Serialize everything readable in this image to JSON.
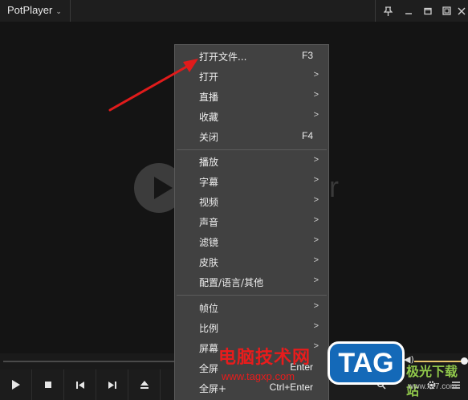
{
  "app": {
    "title": "PotPlayer",
    "logo_text": "r"
  },
  "menu": {
    "groups": [
      [
        {
          "label": "打开文件...",
          "shortcut": "F3"
        },
        {
          "label": "打开",
          "arrow": ">"
        },
        {
          "label": "直播",
          "arrow": ">"
        },
        {
          "label": "收藏",
          "arrow": ">"
        },
        {
          "label": "关闭",
          "shortcut": "F4"
        }
      ],
      [
        {
          "label": "播放",
          "arrow": ">"
        },
        {
          "label": "字幕",
          "arrow": ">"
        },
        {
          "label": "视频",
          "arrow": ">"
        },
        {
          "label": "声音",
          "arrow": ">"
        },
        {
          "label": "滤镜",
          "arrow": ">"
        },
        {
          "label": "皮肤",
          "arrow": ">"
        },
        {
          "label": "配置/语言/其他",
          "arrow": ">"
        }
      ],
      [
        {
          "label": "帧位",
          "arrow": ">"
        },
        {
          "label": "比例",
          "arrow": ">"
        },
        {
          "label": "屏幕",
          "arrow": ">"
        },
        {
          "label": "全屏",
          "shortcut": "Enter"
        },
        {
          "label": "全屏+",
          "shortcut": "Ctrl+Enter"
        }
      ]
    ]
  },
  "watermark": {
    "line1": "电脑技术网",
    "line2": "www.tagxp.com",
    "tag": "TAG",
    "site": "极光下载站",
    "site_url": "www.xz7.com"
  },
  "colors": {
    "menu_bg": "#414141",
    "annotation_arrow": "#e01b1b",
    "volume": "#e8c56a"
  }
}
